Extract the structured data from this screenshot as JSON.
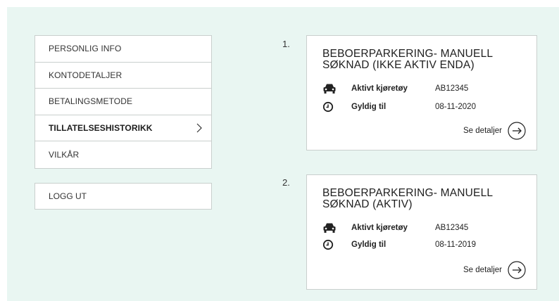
{
  "menu": {
    "items": [
      {
        "label": "PERSONLIG INFO"
      },
      {
        "label": "KONTODETALJER"
      },
      {
        "label": "BETALINGSMETODE"
      },
      {
        "label": "TILLATELSESHISTORIKK"
      },
      {
        "label": "VILKÅR"
      }
    ],
    "active_index": 3,
    "logout_label": "LOGG UT"
  },
  "permits": [
    {
      "number": "1.",
      "title": "BEBOERPARKERING- MANUELL SØKNAD (IKKE AKTIV ENDA)",
      "vehicle_label": "Aktivt kjøretøy",
      "vehicle_value": "AB12345",
      "valid_label": "Gyldig til",
      "valid_value": "08-11-2020",
      "details_label": "Se detaljer"
    },
    {
      "number": "2.",
      "title": "BEBOERPARKERING- MANUELL SØKNAD (AKTIV)",
      "vehicle_label": "Aktivt kjøretøy",
      "vehicle_value": "AB12345",
      "valid_label": "Gyldig til",
      "valid_value": "08-11-2019",
      "details_label": "Se detaljer"
    }
  ],
  "icons": {
    "vehicle": "car-icon",
    "valid": "clock-icon",
    "details": "arrow-right-circle-icon",
    "active_menu": "chevron-right-icon"
  },
  "colors": {
    "background_panel": "#e9f6f2",
    "card_border": "#c9cfcd",
    "text": "#1f1f1f"
  }
}
